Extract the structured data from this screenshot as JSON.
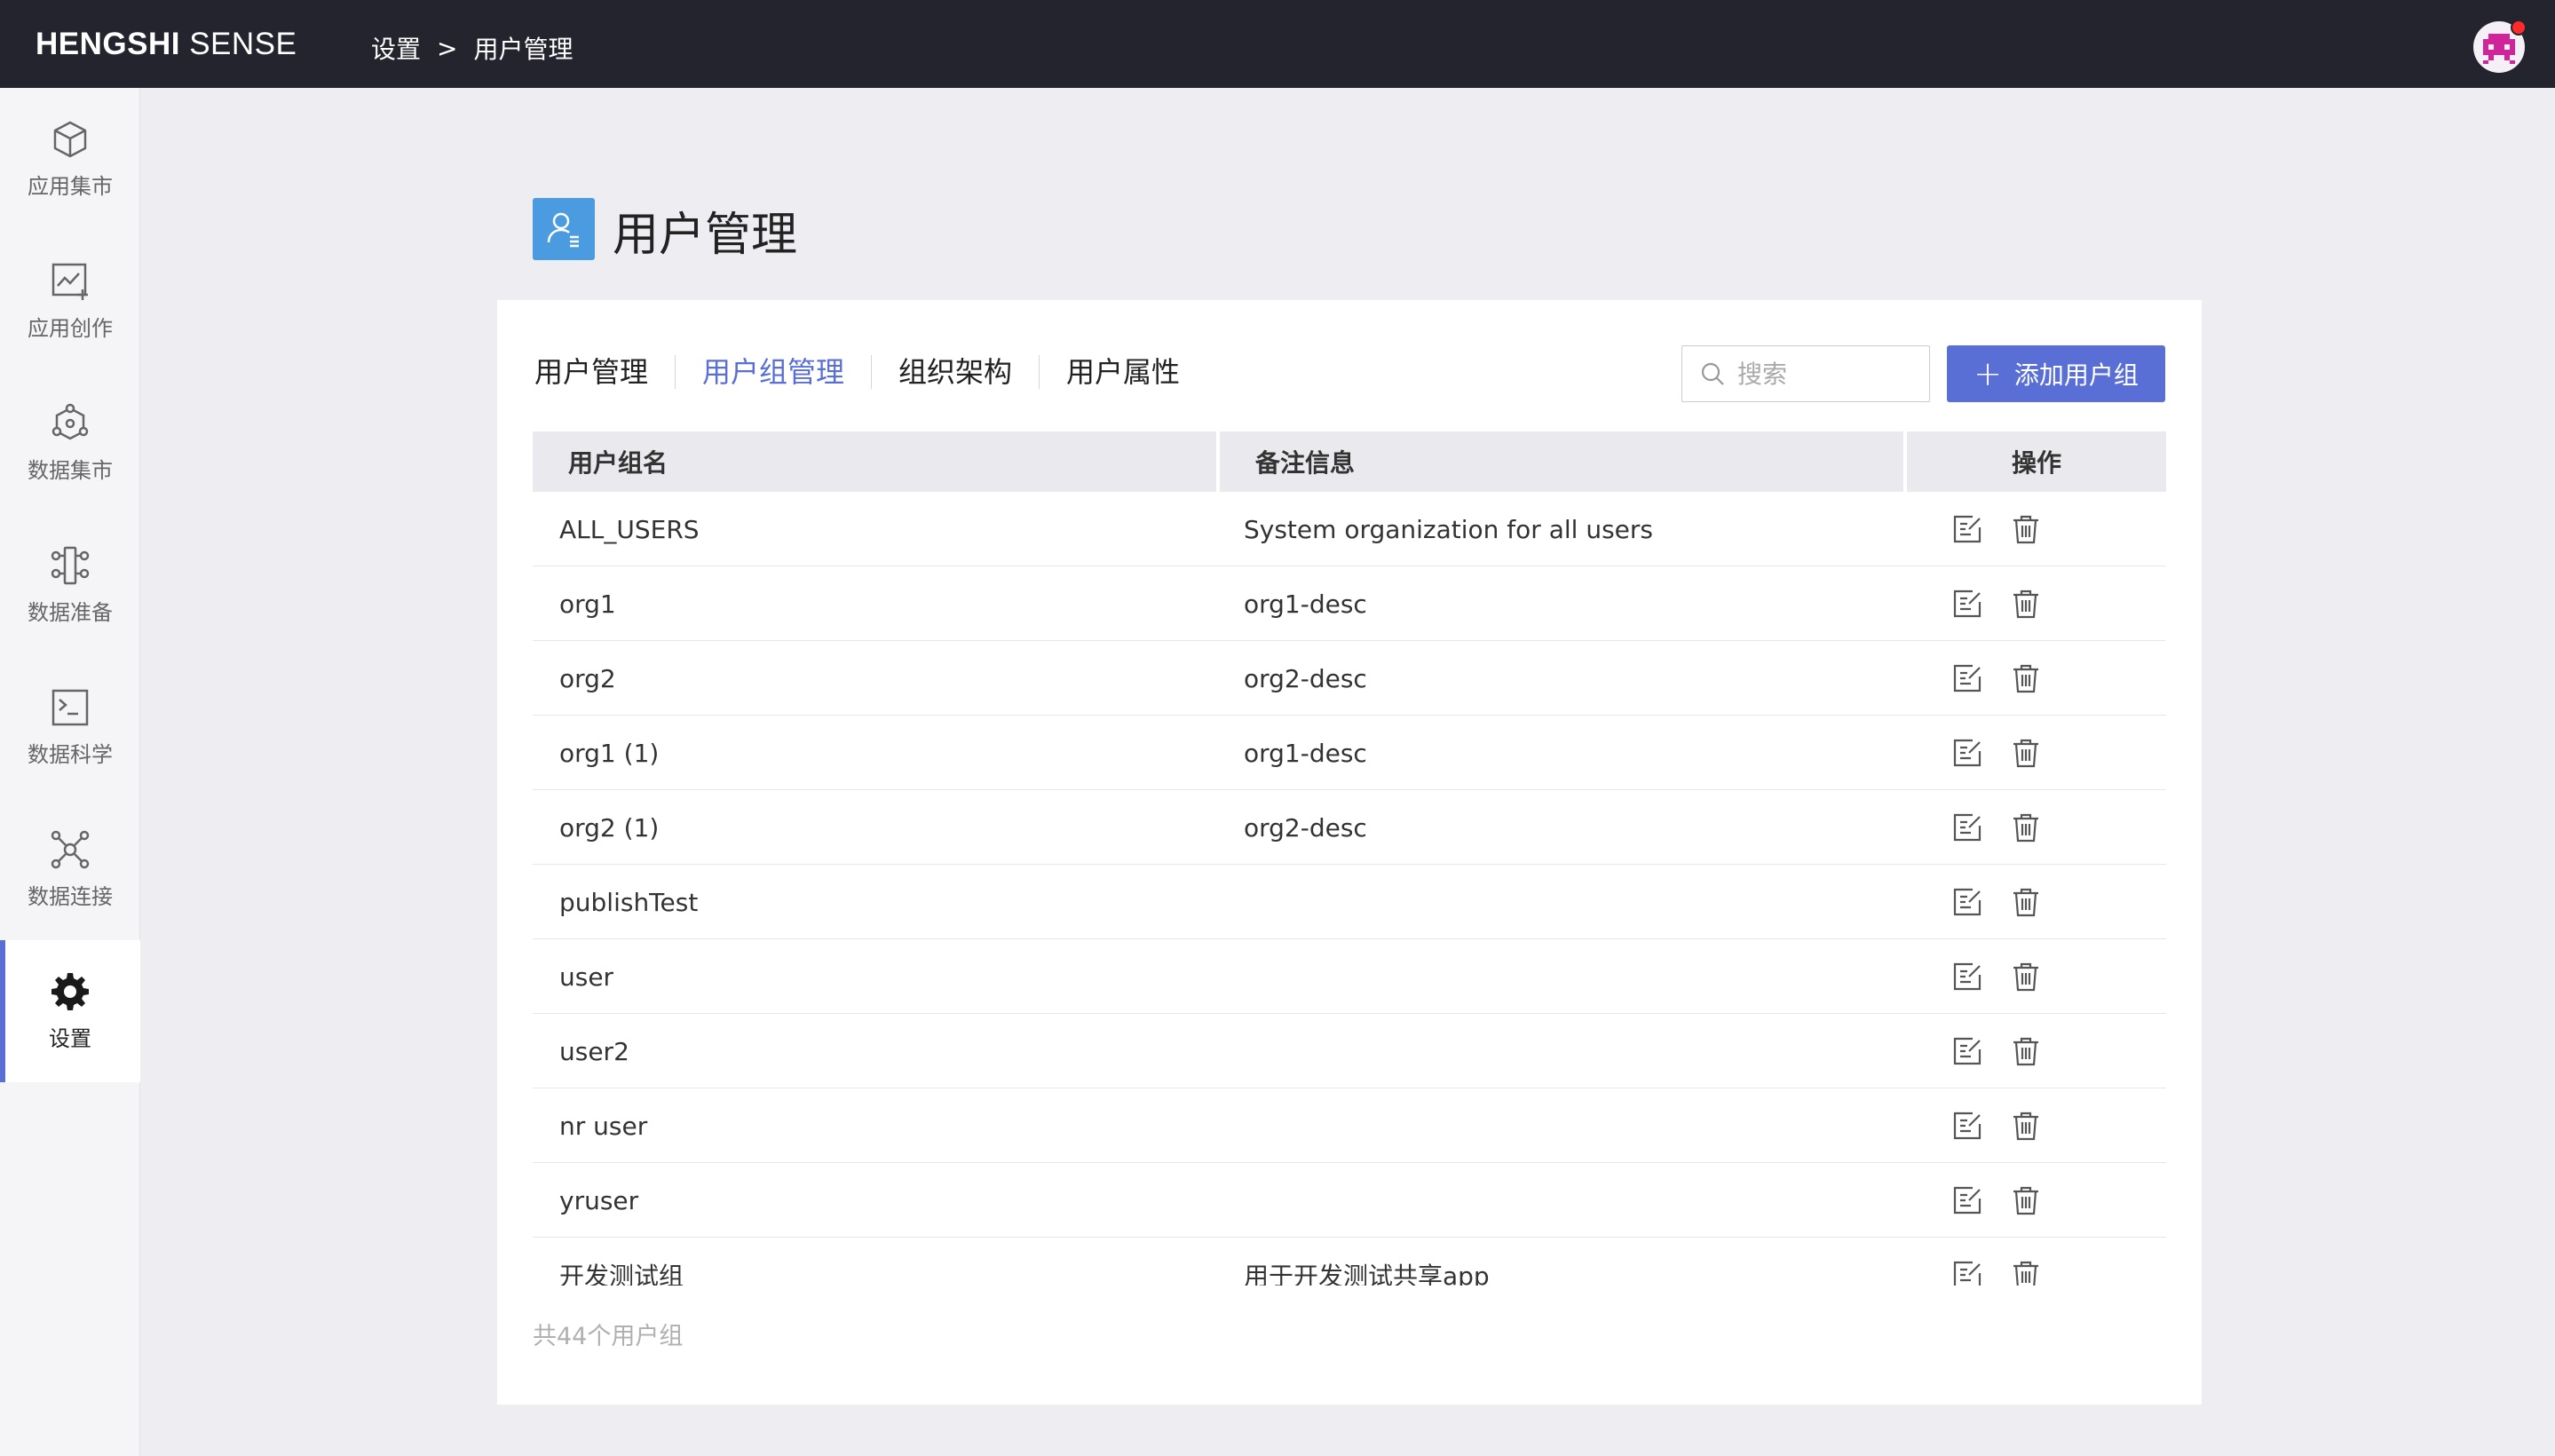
{
  "app": {
    "brand_bold": "HENGSHI",
    "brand_light": "SENSE"
  },
  "breadcrumb": {
    "parent": "设置",
    "sep": ">",
    "current": "用户管理"
  },
  "sidebar": {
    "items": [
      {
        "label": "应用集市",
        "icon": "cube-icon"
      },
      {
        "label": "应用创作",
        "icon": "chart-edit-icon"
      },
      {
        "label": "数据集市",
        "icon": "dataset-hex-icon"
      },
      {
        "label": "数据准备",
        "icon": "flow-icon"
      },
      {
        "label": "数据科学",
        "icon": "terminal-icon"
      },
      {
        "label": "数据连接",
        "icon": "network-icon"
      },
      {
        "label": "设置",
        "icon": "gear-icon",
        "active": true
      }
    ]
  },
  "page": {
    "title": "用户管理"
  },
  "tabs": [
    "用户管理",
    "用户组管理",
    "组织架构",
    "用户属性"
  ],
  "active_tab": "用户组管理",
  "search": {
    "placeholder": "搜索",
    "value": ""
  },
  "add_button": {
    "label": "添加用户组"
  },
  "table": {
    "columns": [
      "用户组名",
      "备注信息",
      "操作"
    ],
    "rows": [
      {
        "name": "ALL_USERS",
        "desc": "System organization for all users"
      },
      {
        "name": "org1",
        "desc": "org1-desc"
      },
      {
        "name": "org2",
        "desc": "org2-desc"
      },
      {
        "name": "org1 (1)",
        "desc": "org1-desc"
      },
      {
        "name": "org2 (1)",
        "desc": "org2-desc"
      },
      {
        "name": "publishTest",
        "desc": ""
      },
      {
        "name": "user",
        "desc": ""
      },
      {
        "name": "user2",
        "desc": ""
      },
      {
        "name": "nr user",
        "desc": ""
      },
      {
        "name": "yruser",
        "desc": ""
      },
      {
        "name": "开发测试组",
        "desc": "用于开发测试共享app"
      }
    ]
  },
  "footer": {
    "total": "共44个用户组"
  },
  "colors": {
    "accent": "#5a6fd6",
    "topbar": "#23242d",
    "page_icon": "#4a9be0",
    "notification": "#ff2a2a"
  }
}
